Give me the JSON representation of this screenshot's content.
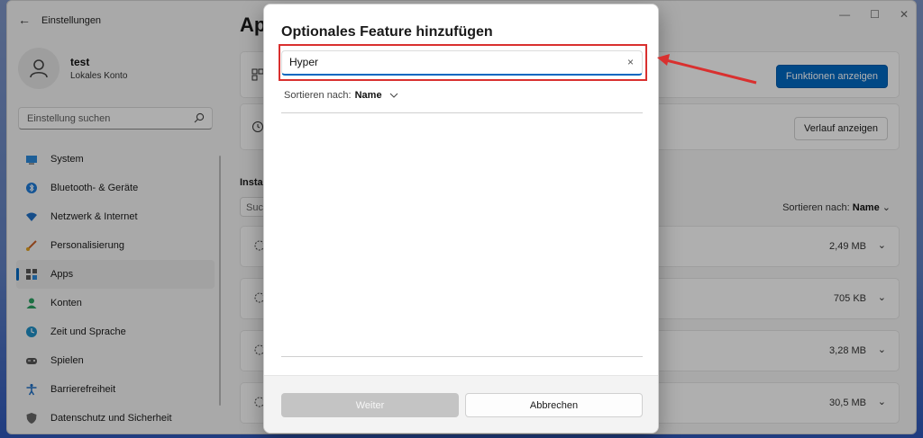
{
  "window": {
    "title": "Einstellungen",
    "minimize": "—",
    "maximize": "☐",
    "close": "✕"
  },
  "profile": {
    "name": "test",
    "account_type": "Lokales Konto"
  },
  "search": {
    "placeholder": "Einstellung suchen"
  },
  "sidebar": {
    "items": [
      {
        "label": "System",
        "icon": "monitor-icon"
      },
      {
        "label": "Bluetooth- & Geräte",
        "icon": "bluetooth-icon"
      },
      {
        "label": "Netzwerk & Internet",
        "icon": "wifi-icon"
      },
      {
        "label": "Personalisierung",
        "icon": "brush-icon"
      },
      {
        "label": "Apps",
        "icon": "apps-icon",
        "active": true
      },
      {
        "label": "Konten",
        "icon": "person-icon"
      },
      {
        "label": "Zeit und Sprache",
        "icon": "globe-clock-icon"
      },
      {
        "label": "Spielen",
        "icon": "gamepad-icon"
      },
      {
        "label": "Barrierefreiheit",
        "icon": "accessibility-icon"
      },
      {
        "label": "Datenschutz und Sicherheit",
        "icon": "shield-icon"
      }
    ]
  },
  "main": {
    "title": "Ap",
    "view_features_label": "Funktionen anzeigen",
    "view_history_label": "Verlauf anzeigen",
    "installed_label": "Insta",
    "installed_search_placeholder": "Suc",
    "sort_label": "Sortieren nach:",
    "sort_value": "Name",
    "features": [
      {
        "size": "2,49 MB"
      },
      {
        "size": "705 KB"
      },
      {
        "size": "3,28 MB"
      },
      {
        "size": "30,5 MB"
      }
    ]
  },
  "dialog": {
    "title": "Optionales Feature hinzufügen",
    "search_value": "Hyper",
    "clear_glyph": "×",
    "sort_label": "Sortieren nach:",
    "sort_value": "Name",
    "next_label": "Weiter",
    "cancel_label": "Abbrechen"
  },
  "colors": {
    "accent": "#0067c0",
    "annotation": "#d9302f"
  }
}
